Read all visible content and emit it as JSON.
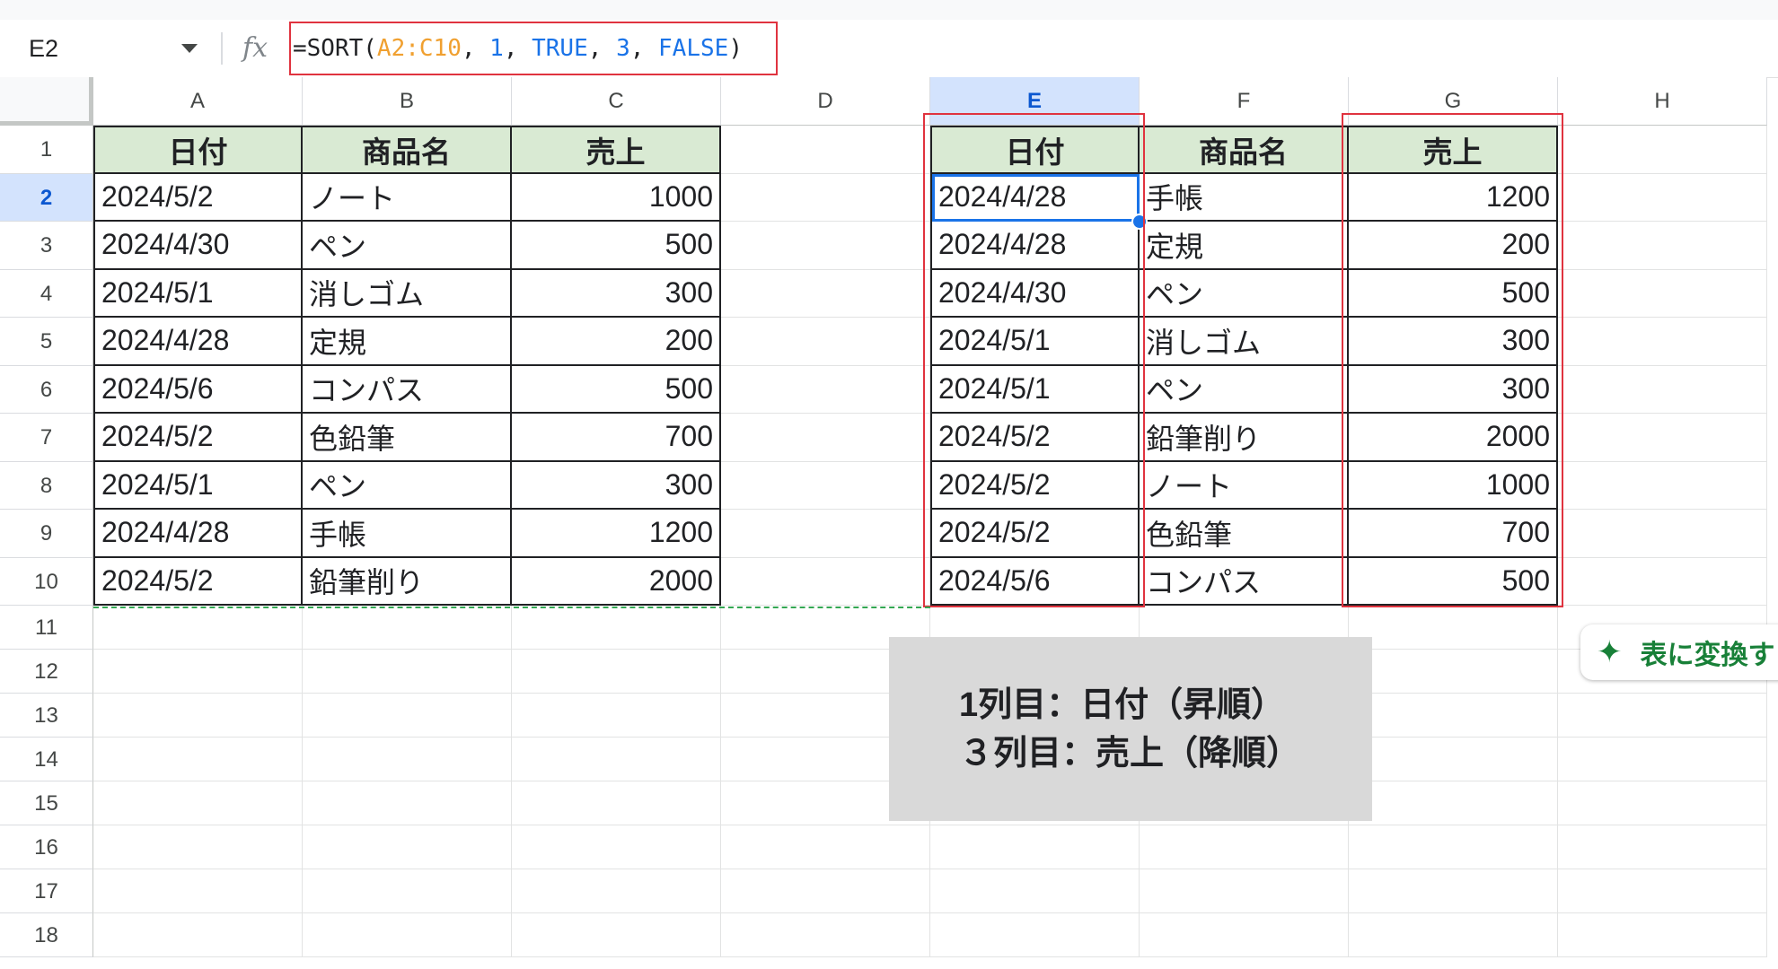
{
  "formula_bar": {
    "name_box": "E2",
    "fx_icon": "function-fx-icon",
    "formula_tokens": [
      {
        "text": "=SORT(",
        "kind": "plain"
      },
      {
        "text": "A2:C10",
        "kind": "range"
      },
      {
        "text": ", ",
        "kind": "plain"
      },
      {
        "text": "1",
        "kind": "num"
      },
      {
        "text": ", ",
        "kind": "plain"
      },
      {
        "text": "TRUE",
        "kind": "num"
      },
      {
        "text": ", ",
        "kind": "plain"
      },
      {
        "text": "3",
        "kind": "num"
      },
      {
        "text": ", ",
        "kind": "plain"
      },
      {
        "text": "FALSE",
        "kind": "num"
      },
      {
        "text": ")",
        "kind": "plain"
      }
    ]
  },
  "columns": [
    "A",
    "B",
    "C",
    "D",
    "E",
    "F",
    "G",
    "H"
  ],
  "selected_column": "E",
  "rows": [
    "1",
    "2",
    "3",
    "4",
    "5",
    "6",
    "7",
    "8",
    "9",
    "10",
    "11",
    "12",
    "13",
    "14",
    "15",
    "16",
    "17",
    "18"
  ],
  "selected_row": "2",
  "source_table": {
    "headers": [
      "日付",
      "商品名",
      "売上"
    ],
    "rows": [
      [
        "2024/5/2",
        "ノート",
        "1000"
      ],
      [
        "2024/4/30",
        "ペン",
        "500"
      ],
      [
        "2024/5/1",
        "消しゴム",
        "300"
      ],
      [
        "2024/4/28",
        "定規",
        "200"
      ],
      [
        "2024/5/6",
        "コンパス",
        "500"
      ],
      [
        "2024/5/2",
        "色鉛筆",
        "700"
      ],
      [
        "2024/5/1",
        "ペン",
        "300"
      ],
      [
        "2024/4/28",
        "手帳",
        "1200"
      ],
      [
        "2024/5/2",
        "鉛筆削り",
        "2000"
      ]
    ]
  },
  "sorted_table": {
    "headers": [
      "日付",
      "商品名",
      "売上"
    ],
    "rows": [
      [
        "2024/4/28",
        "手帳",
        "1200"
      ],
      [
        "2024/4/28",
        "定規",
        "200"
      ],
      [
        "2024/4/30",
        "ペン",
        "500"
      ],
      [
        "2024/5/1",
        "消しゴム",
        "300"
      ],
      [
        "2024/5/1",
        "ペン",
        "300"
      ],
      [
        "2024/5/2",
        "鉛筆削り",
        "2000"
      ],
      [
        "2024/5/2",
        "ノート",
        "1000"
      ],
      [
        "2024/5/2",
        "色鉛筆",
        "700"
      ],
      [
        "2024/5/6",
        "コンパス",
        "500"
      ]
    ]
  },
  "annotation": {
    "line1": "1列目：日付（昇順）",
    "line2": "３列目：売上（降順）"
  },
  "convert_chip": {
    "icon": "sparkle-icon",
    "label": "表に変換す"
  },
  "colors": {
    "header_fill": "#d9ead3",
    "highlight_border": "#e0333f",
    "selection_blue": "#1a73e8",
    "range_token": "#f0a030",
    "number_token": "#1a73e8",
    "chip_green": "#188038"
  }
}
